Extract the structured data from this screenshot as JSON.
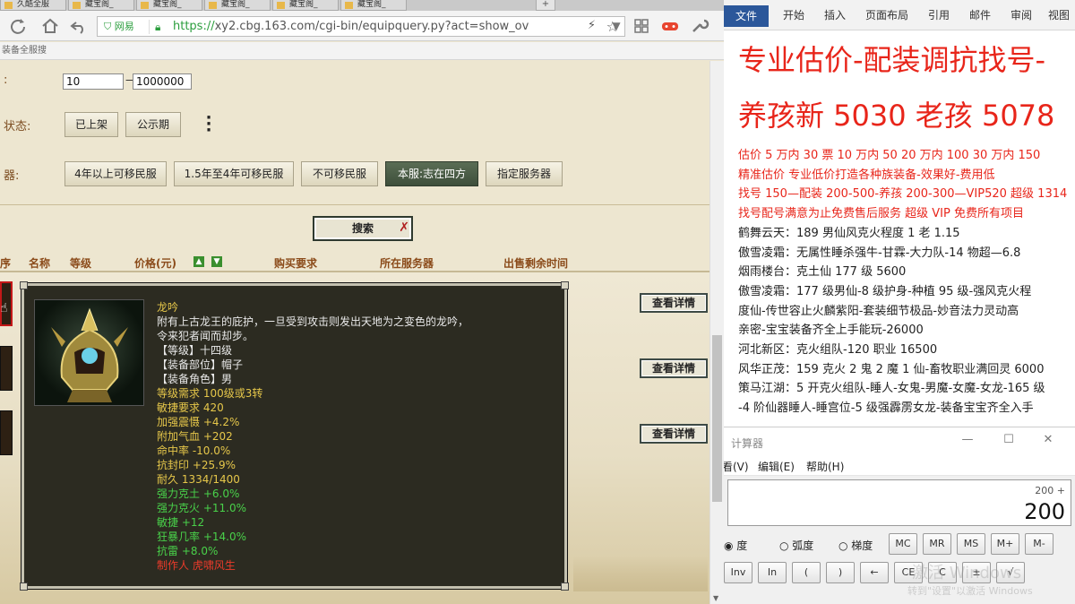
{
  "browser": {
    "tabs": [
      "久酷全服",
      "藏宝阁_",
      "藏宝阁_",
      "藏宝阁_",
      "藏宝阁_",
      "藏宝阁_"
    ],
    "url": {
      "badge": "网易",
      "scheme": "https://",
      "rest": "xy2.cbg.163.com/cgi-bin/equipquery.py?act=show_ov"
    },
    "bookmarks": "装备全服搜"
  },
  "filters": {
    "price_label": ":",
    "price_min": "10",
    "price_sep": "—",
    "price_max": "1000000",
    "status_label": "状态:",
    "status_buttons": [
      "已上架",
      "公示期"
    ],
    "server_label": "器:",
    "server_buttons": [
      "4年以上可移民服",
      "1.5年至4年可移民服",
      "不可移民服",
      "本服:志在四方",
      "指定服务器"
    ],
    "search_label": "搜索"
  },
  "table": {
    "headers": [
      "序",
      "名称",
      "等级",
      "价格(元)",
      "购买要求",
      "所在服务器",
      "出售剩余时间"
    ],
    "detail_label": "查看详情"
  },
  "item": {
    "name": "龙吟",
    "desc1": "附有上古龙王的庇护，一旦受到攻击则发出天地为之变色的龙吟，",
    "desc2": "令来犯者闻而却步。",
    "base_lines": [
      "【等级】十四级",
      "【装备部位】帽子",
      "【装备角色】男"
    ],
    "req_lines": [
      "等级需求 100级或3转",
      "敏捷要求 420"
    ],
    "attr_lines": [
      "加强震慑 +4.2%",
      "附加气血 +202",
      "命中率 -10.0%",
      "抗封印 +25.9%",
      "耐久 1334/1400"
    ],
    "green_lines": [
      "强力克土 +6.0%",
      "强力克火 +11.0%",
      "敏捷 +12",
      "狂暴几率 +14.0%",
      "抗雷 +8.0%"
    ],
    "maker": "制作人 虎啸风生"
  },
  "word": {
    "tabs": [
      "文件",
      "开始",
      "插入",
      "页面布局",
      "引用",
      "邮件",
      "审阅",
      "视图"
    ],
    "doc_lines": [
      {
        "text": "专业估价-配装调抗找号-",
        "style": "big"
      },
      {
        "text": "养孩新 5030 老孩 5078",
        "style": "big"
      },
      {
        "text": "估价 5 万内 30 票   10 万内 50  20 万内 100  30 万内 150",
        "style": "med"
      },
      {
        "text": "精准估价  专业低价打造各种族装备-效果好-费用低",
        "style": "med"
      },
      {
        "text": "找号 150—配装 200-500-养孩 200-300—VIP520 超级 1314",
        "style": "med"
      },
      {
        "text": "找号配号满意为止免费售后服务   超级 VIP 免费所有项目",
        "style": "med"
      },
      {
        "text": "鹤舞云天：189 男仙风克火程度 1 老 1.15",
        "style": "blk"
      },
      {
        "text": "傲雪凌霜：无属性睡杀强牛-甘霖-大力队-14 物超—6.8",
        "style": "blk"
      },
      {
        "text": "烟雨楼台：克土仙 177 级 5600",
        "style": "blk"
      },
      {
        "text": "傲雪凌霜：177 级男仙-8 级护身-种植 95 级-强风克火程",
        "style": "blk"
      },
      {
        "text": "度仙-传世容止火麟紫阳-套装细节极品-妙音法力灵动高",
        "style": "blk"
      },
      {
        "text": "亲密-宝宝装备齐全上手能玩-26000",
        "style": "blk"
      },
      {
        "text": "河北新区：克火组队-120 职业 16500",
        "style": "blk"
      },
      {
        "text": "风华正茂：159 克火 2 鬼 2 魔 1 仙-畜牧职业满回灵 6000",
        "style": "blk"
      },
      {
        "text": "策马江湖：5 开克火组队-睡人-女鬼-男魔-女魔-女龙-165 级",
        "style": "blk"
      },
      {
        "text": "-4 阶仙器睡人-睡宫位-5 级强霹雳女龙-装备宝宝齐全入手",
        "style": "blk"
      }
    ]
  },
  "calculator": {
    "title": "计算器",
    "menu": [
      "看(V)",
      "编辑(E)",
      "帮助(H)"
    ],
    "expression": "200 +",
    "value": "200",
    "modes": [
      "度",
      "弧度",
      "梯度"
    ],
    "mem_buttons": [
      "MC",
      "MR",
      "MS",
      "M+",
      "M-"
    ],
    "row2_buttons": [
      "Inv",
      "In",
      "(",
      ")",
      "←",
      "CE",
      "C",
      "±",
      "√"
    ],
    "watermark1": "激活 Windows",
    "watermark2": "转到\"设置\"以激活 Windows"
  }
}
